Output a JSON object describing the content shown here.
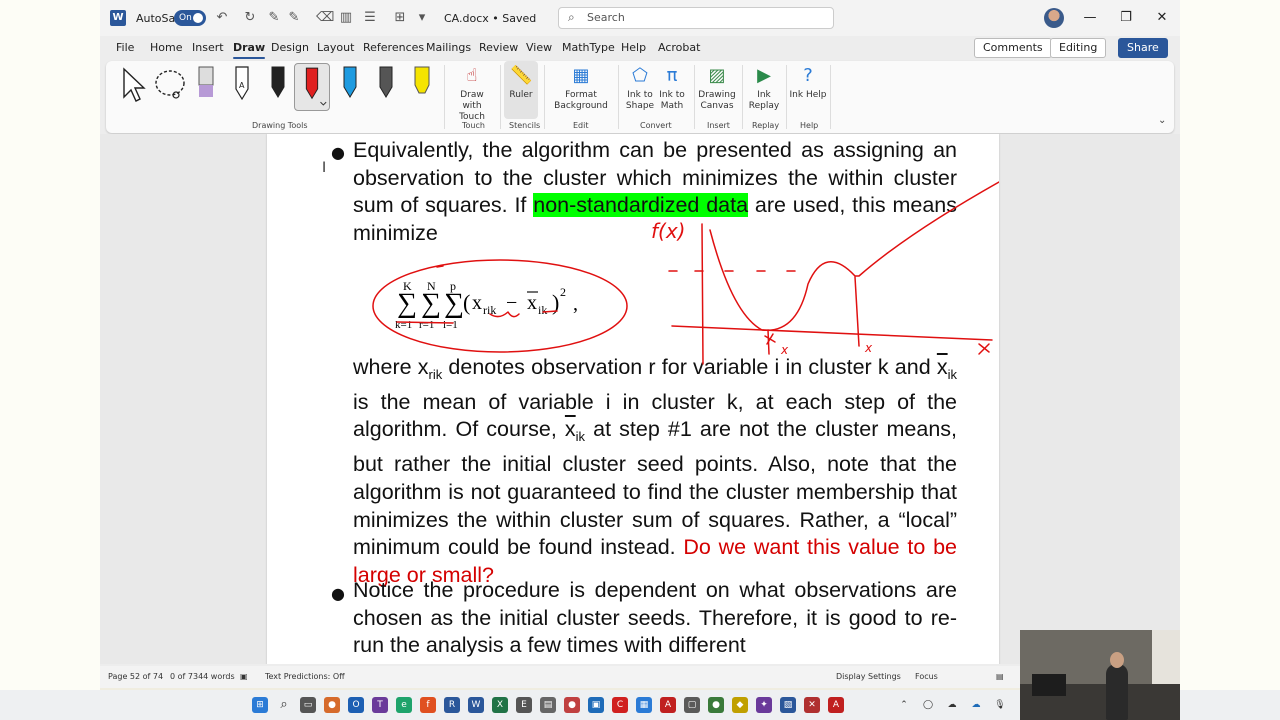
{
  "titlebar": {
    "autosave_label": "AutoSave",
    "autosave_state": "On",
    "doc_title": "CA.docx • Saved",
    "search_placeholder": "Search"
  },
  "menu": {
    "tabs": [
      "File",
      "Home",
      "Insert",
      "Draw",
      "Design",
      "Layout",
      "References",
      "Mailings",
      "Review",
      "View",
      "MathType",
      "Help",
      "Acrobat"
    ],
    "active_tab": "Draw",
    "comments_label": "Comments",
    "editing_label": "Editing",
    "share_label": "Share"
  },
  "ribbon": {
    "groups": {
      "drawing_tools": "Drawing Tools",
      "touch": "Touch",
      "stencils": "Stencils",
      "edit": "Edit",
      "convert": "Convert",
      "insert": "Insert",
      "replay": "Replay",
      "help": "Help"
    },
    "buttons": {
      "draw_with_touch": "Draw with Touch",
      "ruler": "Ruler",
      "format_background": "Format Background",
      "ink_to_shape": "Ink to Shape",
      "ink_to_math": "Ink to Math",
      "drawing_canvas": "Drawing Canvas",
      "ink_replay": "Ink Replay",
      "ink_help": "Ink Help"
    },
    "pen_colors": [
      "#222222",
      "#e02020",
      "#1e9be0",
      "#555555",
      "#f5e400"
    ],
    "highlighter_color": "#b79ad6"
  },
  "document": {
    "p1_a": "Equivalently, the algorithm can be presented as assigning an observation to the cluster which minimizes the within cluster sum of squares. If",
    "p1_hl": "non-standardized data",
    "p1_b": "are used, this means minimize",
    "formula": {
      "K": "K",
      "N": "N",
      "p": "p",
      "idx_k": "k=1",
      "idx_r": "r=1",
      "idx_i": "i=1",
      "x": "x",
      "x_sub": "rik",
      "minus": "−",
      "xbar": "x",
      "xbar_sub": "ik",
      "exp": "2"
    },
    "p2_a": "where",
    "p2_x": "x",
    "p2_x_sub": "rik",
    "p2_b": "denotes observation r for variable i in cluster k and",
    "p2_xbar": "x",
    "p2_xbar_sub": "ik",
    "p2_c": "is the mean of variable i in cluster k, at each step of the algorithm. Of course,",
    "p2_xbar2": "x",
    "p2_xbar2_sub": "ik",
    "p2_d": "at step #1 are not the cluster means, but rather the initial cluster seed points. Also, note that the algorithm is not guaranteed to find the cluster membership that minimizes the within cluster sum of squares. Rather, a “local” minimum could be found instead.",
    "p2_red": "Do we want this value to be large or small?",
    "p3": "Notice the procedure is dependent on what observations are chosen as the initial cluster seeds. Therefore, it is good to re-run the analysis a few times with different"
  },
  "ink_labels": {
    "fx": "f(x)",
    "x_axis": "x"
  },
  "status": {
    "page": "Page 52 of 74",
    "words": "0 of 7344 words",
    "text_predictions": "Text Predictions: Off",
    "display_settings": "Display Settings",
    "focus": "Focus"
  },
  "colors": {
    "word_blue": "#2b579a",
    "highlight": "#00ff00",
    "red_text": "#d40000",
    "ink_red": "#e01010"
  }
}
